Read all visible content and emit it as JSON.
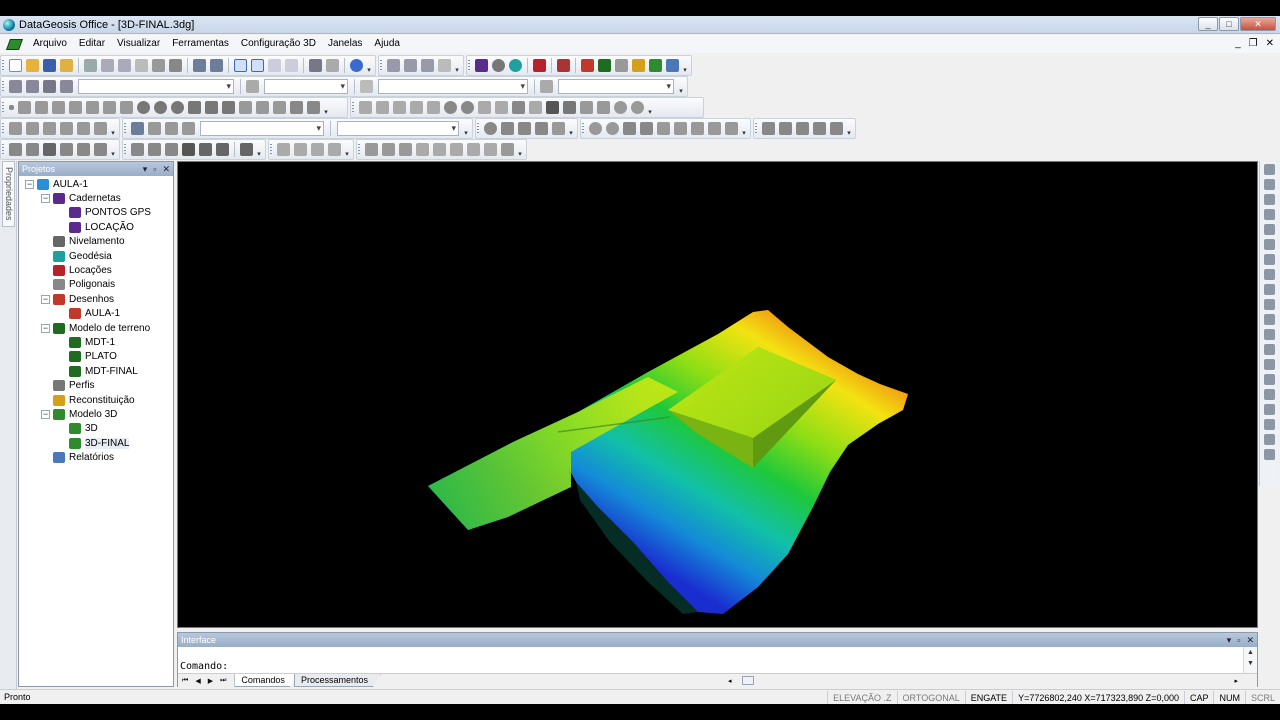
{
  "window": {
    "title": "DataGeosis Office - [3D-FINAL.3dg]",
    "controls": {
      "minimize": "_",
      "maximize": "□",
      "close": "✕"
    }
  },
  "menu": {
    "items": [
      "Arquivo",
      "Editar",
      "Visualizar",
      "Ferramentas",
      "Configuração 3D",
      "Janelas",
      "Ajuda"
    ],
    "mdi_controls": {
      "minimize": "_",
      "restore": "❐",
      "close": "✕"
    }
  },
  "left_strip": {
    "tab_label": "Propriedades"
  },
  "projects_panel": {
    "title": "Projetos",
    "controls": {
      "dropdown": "▾",
      "pin": "▫",
      "close": "✕"
    },
    "tree": [
      {
        "label": "AULA-1",
        "level": 0,
        "expanded": "−",
        "icon": "globe-icon",
        "color": "#2a8fd6"
      },
      {
        "label": "Cadernetas",
        "level": 1,
        "expanded": "−",
        "icon": "grid-book-icon",
        "color": "#5a2b8c"
      },
      {
        "label": "PONTOS GPS",
        "level": 2,
        "expanded": "",
        "icon": "grid-book-icon",
        "color": "#5a2b8c"
      },
      {
        "label": "LOCAÇÃO",
        "level": 2,
        "expanded": "",
        "icon": "grid-book-icon",
        "color": "#5a2b8c"
      },
      {
        "label": "Nivelamento",
        "level": 1,
        "expanded": "",
        "icon": "level-icon",
        "color": "#666666"
      },
      {
        "label": "Geodésia",
        "level": 1,
        "expanded": "",
        "icon": "earth-icon",
        "color": "#1fa0a0"
      },
      {
        "label": "Locações",
        "level": 1,
        "expanded": "",
        "icon": "lock-icon",
        "color": "#b8202a"
      },
      {
        "label": "Poligonais",
        "level": 1,
        "expanded": "",
        "icon": "polygon-line-icon",
        "color": "#888888"
      },
      {
        "label": "Desenhos",
        "level": 1,
        "expanded": "−",
        "icon": "drawing-icon",
        "color": "#c0392b"
      },
      {
        "label": "AULA-1",
        "level": 2,
        "expanded": "",
        "icon": "drawing-icon",
        "color": "#c0392b"
      },
      {
        "label": "Modelo de terreno",
        "level": 1,
        "expanded": "−",
        "icon": "terrain-icon",
        "color": "#1f6b1f"
      },
      {
        "label": "MDT-1",
        "level": 2,
        "expanded": "",
        "icon": "terrain-icon",
        "color": "#1f6b1f"
      },
      {
        "label": "PLATO",
        "level": 2,
        "expanded": "",
        "icon": "terrain-icon",
        "color": "#1f6b1f"
      },
      {
        "label": "MDT-FINAL",
        "level": 2,
        "expanded": "",
        "icon": "terrain-icon",
        "color": "#1f6b1f"
      },
      {
        "label": "Perfis",
        "level": 1,
        "expanded": "",
        "icon": "profile-icon",
        "color": "#777777"
      },
      {
        "label": "Reconstituição",
        "level": 1,
        "expanded": "",
        "icon": "reconstruction-icon",
        "color": "#d4a017"
      },
      {
        "label": "Modelo 3D",
        "level": 1,
        "expanded": "−",
        "icon": "model3d-icon",
        "color": "#2e8b2e"
      },
      {
        "label": "3D",
        "level": 2,
        "expanded": "",
        "icon": "model3d-icon",
        "color": "#2e8b2e"
      },
      {
        "label": "3D-FINAL",
        "level": 2,
        "expanded": "",
        "icon": "model3d-icon",
        "color": "#2e8b2e",
        "selected": true
      },
      {
        "label": "Relatórios",
        "level": 1,
        "expanded": "",
        "icon": "report-icon",
        "color": "#4a78b8"
      }
    ]
  },
  "interface_panel": {
    "title": "Interface",
    "controls": {
      "dropdown": "▾",
      "pin": "▫",
      "close": "✕"
    },
    "command_prompt": "Comando:",
    "tabs": [
      "Comandos",
      "Processamentos"
    ],
    "tab_nav": [
      "⏮",
      "◀",
      "▶",
      "⏭"
    ]
  },
  "status": {
    "left": "Pronto",
    "elevation": "ELEVAÇÃO .Z",
    "ortho": "ORTOGONAL",
    "snap": "ENGATE",
    "coords": "Y=7726802,240 X=717323,890 Z=0,000",
    "cap": "CAP",
    "num": "NUM",
    "scrl": "SCRL"
  },
  "colors": {
    "terrain_high": "#d01818",
    "terrain_mid": "#8ede14",
    "terrain_low": "#1a2ed0",
    "panel_header": "#a9bbd3"
  }
}
